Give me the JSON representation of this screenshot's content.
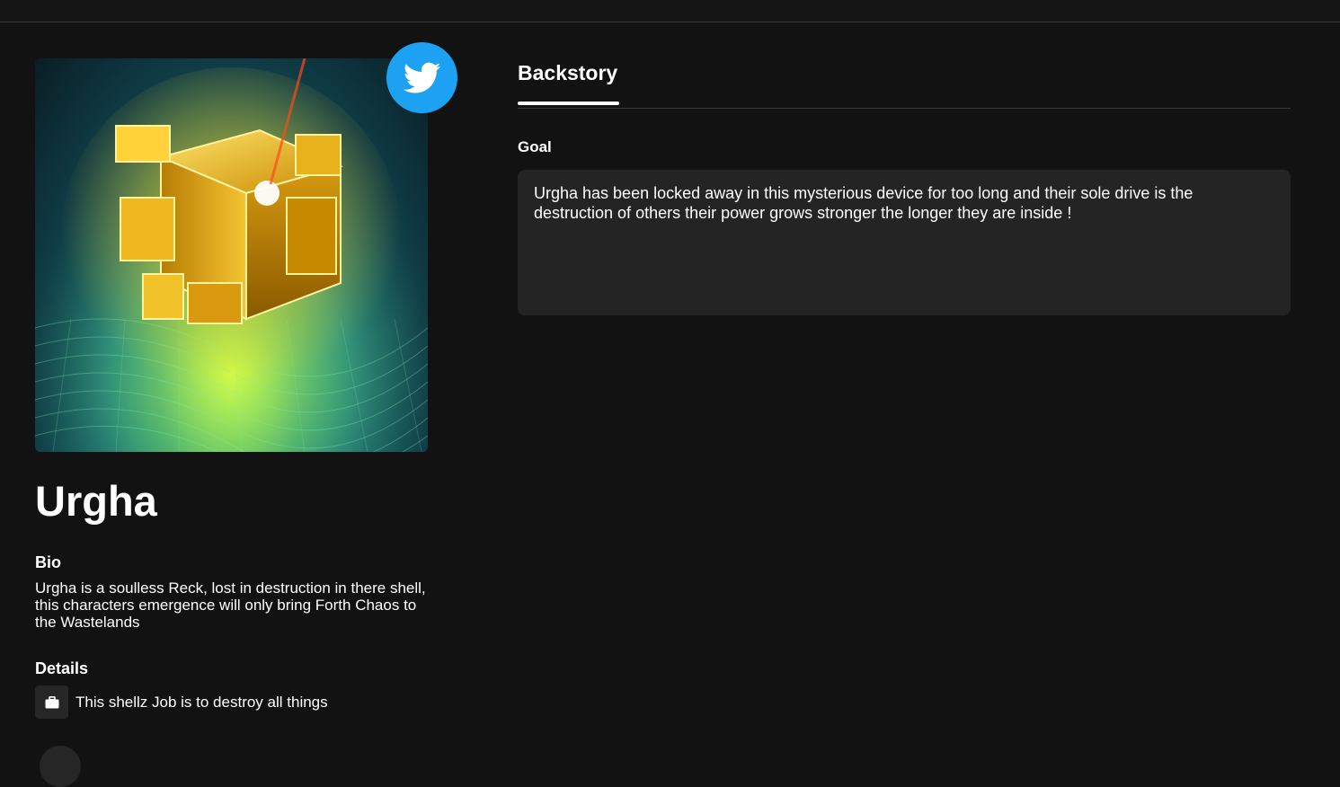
{
  "character": {
    "name": "Urgha",
    "bio_label": "Bio",
    "bio_text": "Urgha is a soulless Reck, lost in destruction in there shell, this characters emergence will only bring Forth Chaos to the Wastelands",
    "details_label": "Details",
    "details": [
      {
        "icon": "briefcase-icon",
        "text": "This shellz Job is to destroy all things"
      }
    ],
    "image_description_icon": "glowing-cube-artwork",
    "social": {
      "icon": "twitter-icon",
      "color": "#1da1f2"
    }
  },
  "tabs": [
    {
      "label": "Backstory",
      "active": true
    }
  ],
  "backstory": {
    "goal_label": "Goal",
    "goal_text": "Urgha has been locked away in this mysterious device for too long and their sole drive is the destruction of others their power grows stronger the longer they are inside !"
  },
  "colors": {
    "background": "#121212",
    "panel": "#242424",
    "accent": "#1da1f2"
  }
}
